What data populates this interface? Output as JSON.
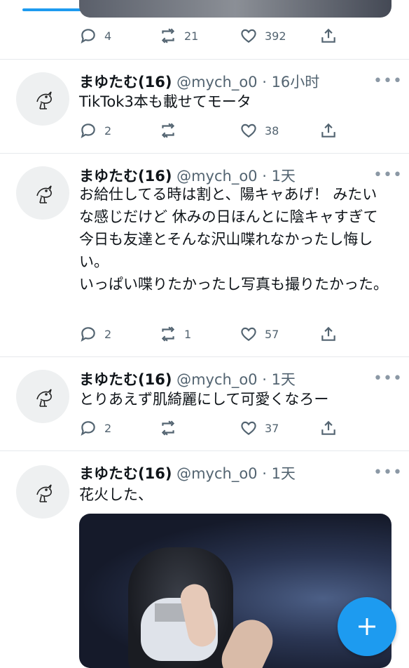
{
  "top_tweet": {
    "reply_count": "4",
    "retweet_count": "21",
    "like_count": "392"
  },
  "tweets": [
    {
      "name": "まゆたむ(16)",
      "meta": " @mych_o0 · 16小时",
      "text": "TikTok3本も載せてモータ",
      "replies": "2",
      "retweets": "",
      "likes": "38",
      "more": "•••"
    },
    {
      "name": "まゆたむ(16)",
      "meta": " @mych_o0 · 1天",
      "text": "お給仕してる時は割と、陽キャあげ！ みたいな感じだけど 休みの日ほんとに陰キャすぎて 今日も友達とそんな沢山喋れなかったし悔しい。\nいっぱい喋りたかったし写真も撮りたかった。",
      "replies": "2",
      "retweets": "1",
      "likes": "57",
      "more": "•••"
    },
    {
      "name": "まゆたむ(16)",
      "meta": " @mych_o0 · 1天",
      "text": "とりあえず肌綺麗にして可愛くなろー",
      "replies": "2",
      "retweets": "",
      "likes": "37",
      "more": "•••"
    },
    {
      "name": "まゆたむ(16)",
      "meta": " @mych_o0 · 1天",
      "text": "花火した、",
      "more": "•••"
    }
  ],
  "icons": {
    "reply": "reply-icon",
    "retweet": "retweet-icon",
    "like": "heart-icon",
    "share": "share-icon",
    "avatar": "bird-icon",
    "compose": "plus-icon"
  },
  "colors": {
    "accent": "#1d9bf0",
    "muted": "#536471"
  }
}
